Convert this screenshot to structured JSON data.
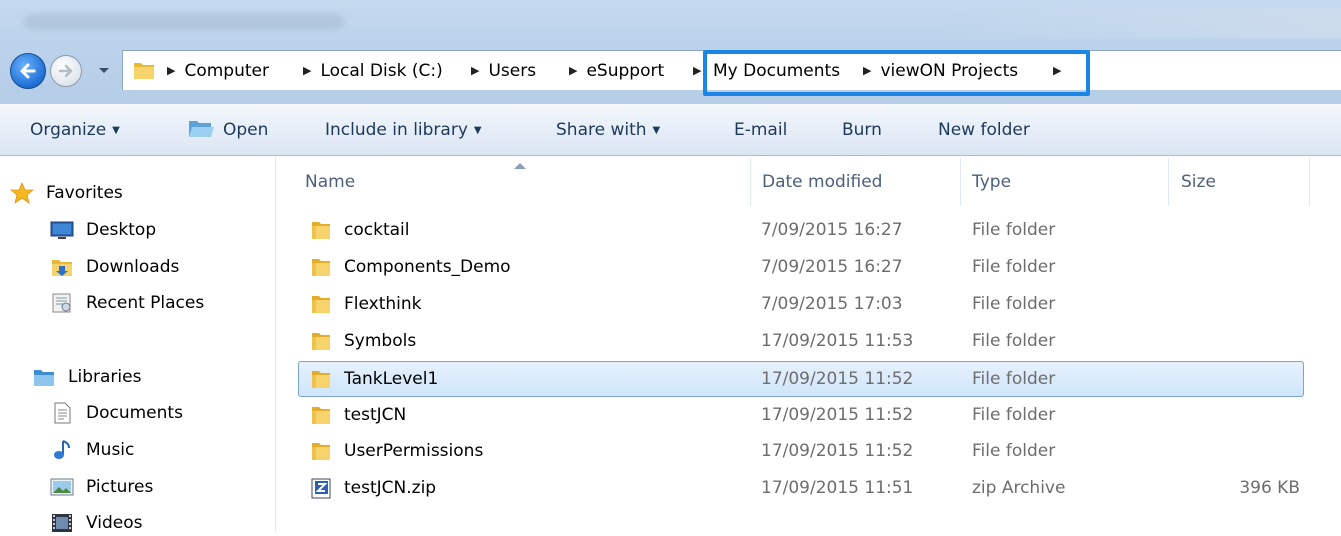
{
  "address_bar": {
    "breadcrumbs": [
      {
        "label": "Computer"
      },
      {
        "label": "Local Disk (C:)"
      },
      {
        "label": "Users"
      },
      {
        "label": "eSupport"
      },
      {
        "label": "My Documents"
      },
      {
        "label": "viewON Projects"
      }
    ]
  },
  "toolbar": {
    "organize_label": "Organize",
    "open_label": "Open",
    "include_label": "Include in library",
    "share_label": "Share with",
    "email_label": "E-mail",
    "burn_label": "Burn",
    "new_folder_label": "New folder"
  },
  "nav_pane": {
    "favorites": {
      "label": "Favorites",
      "items": [
        {
          "label": "Desktop"
        },
        {
          "label": "Downloads"
        },
        {
          "label": "Recent Places"
        }
      ]
    },
    "libraries": {
      "label": "Libraries",
      "items": [
        {
          "label": "Documents"
        },
        {
          "label": "Music"
        },
        {
          "label": "Pictures"
        },
        {
          "label": "Videos"
        }
      ]
    }
  },
  "file_list": {
    "columns": {
      "name": "Name",
      "date": "Date modified",
      "type": "Type",
      "size": "Size"
    },
    "rows": [
      {
        "name": "cocktail",
        "date": "7/09/2015 16:27",
        "type": "File folder",
        "size": "",
        "icon": "folder-icon"
      },
      {
        "name": "Components_Demo",
        "date": "7/09/2015 16:27",
        "type": "File folder",
        "size": "",
        "icon": "folder-icon"
      },
      {
        "name": "Flexthink",
        "date": "7/09/2015 17:03",
        "type": "File folder",
        "size": "",
        "icon": "folder-icon"
      },
      {
        "name": "Symbols",
        "date": "17/09/2015 11:53",
        "type": "File folder",
        "size": "",
        "icon": "folder-icon"
      },
      {
        "name": "TankLevel1",
        "date": "17/09/2015 11:52",
        "type": "File folder",
        "size": "",
        "icon": "folder-icon",
        "selected": true
      },
      {
        "name": "testJCN",
        "date": "17/09/2015 11:52",
        "type": "File folder",
        "size": "",
        "icon": "folder-icon"
      },
      {
        "name": "UserPermissions",
        "date": "17/09/2015 11:52",
        "type": "File folder",
        "size": "",
        "icon": "folder-icon"
      },
      {
        "name": "testJCN.zip",
        "date": "17/09/2015 11:51",
        "type": "zip Archive",
        "size": "396 KB",
        "icon": "zip-archive-icon"
      }
    ]
  },
  "colors": {
    "highlight_box": "#1c86e6",
    "selection_fill": "#cfe5fb",
    "selection_border": "#7da2ce",
    "folder_yellow": "#f2c94c"
  }
}
